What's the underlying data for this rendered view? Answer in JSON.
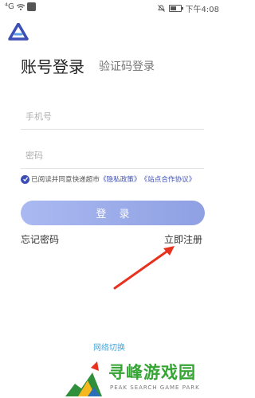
{
  "status_bar": {
    "time": "下午4:08",
    "carrier_small": "⁴G"
  },
  "tabs": {
    "account_login": "账号登录",
    "code_login": "验证码登录"
  },
  "form": {
    "phone_placeholder": "手机号",
    "password_placeholder": "密码"
  },
  "agreement": {
    "text": "已阅读并同意快递超市",
    "privacy_link": "《隐私政策》",
    "site_link": "《站点合作协议》"
  },
  "login_button": "登 录",
  "forgot_password": "忘记密码",
  "register_now": "立即注册",
  "network_switch": "网络切换",
  "watermark": {
    "title": "寻峰游戏园",
    "subtitle": "PEAK SEARCH GAME PARK"
  },
  "colors": {
    "brand": "#3d4fb5",
    "button_start": "#aab9f1",
    "button_end": "#8fa0e3",
    "link": "#3fa7de",
    "arrow": "#e8321f",
    "watermark_green": "#35a534"
  }
}
